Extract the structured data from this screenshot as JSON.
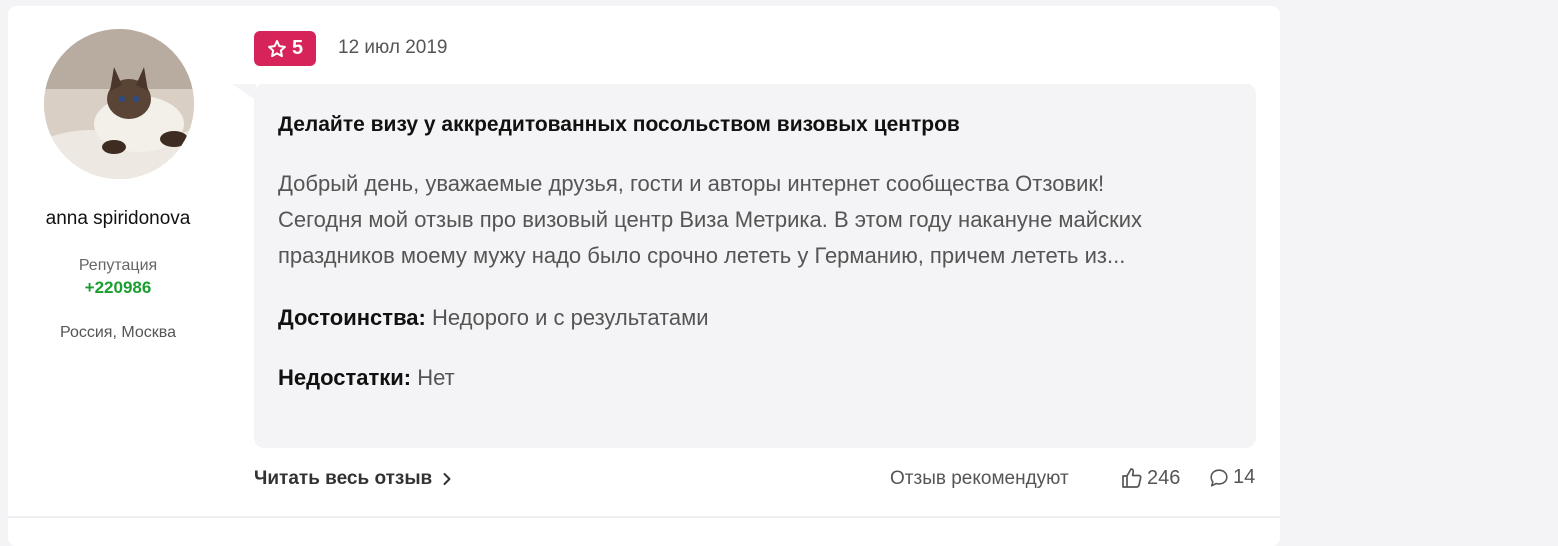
{
  "author": {
    "name": "anna spiridonova",
    "reputation_label": "Репутация",
    "reputation_value": "+220986",
    "location": "Россия, Москва"
  },
  "review": {
    "rating": "5",
    "date": "12 июл 2019",
    "title": "Делайте визу у аккредитованных посольством визовых центров",
    "text": "Добрый день, уважаемые друзья, гости и авторы интернет сообщества Отзовик! Сегодня мой отзыв про визовый центр Виза Метрика. В этом году накануне майских праздников моему мужу надо было срочно лететь у Германию, причем лететь из...",
    "pros_label": "Достоинства:",
    "pros_value": "Недорого и с результатами",
    "cons_label": "Недостатки:",
    "cons_value": "Нет"
  },
  "footer": {
    "read_more": "Читать весь отзыв",
    "recommend_label": "Отзыв рекомендуют",
    "likes": "246",
    "comments": "14"
  },
  "colors": {
    "badge": "#d6235a",
    "reputation": "#1a9e2f",
    "bubble": "#f4f4f6"
  }
}
